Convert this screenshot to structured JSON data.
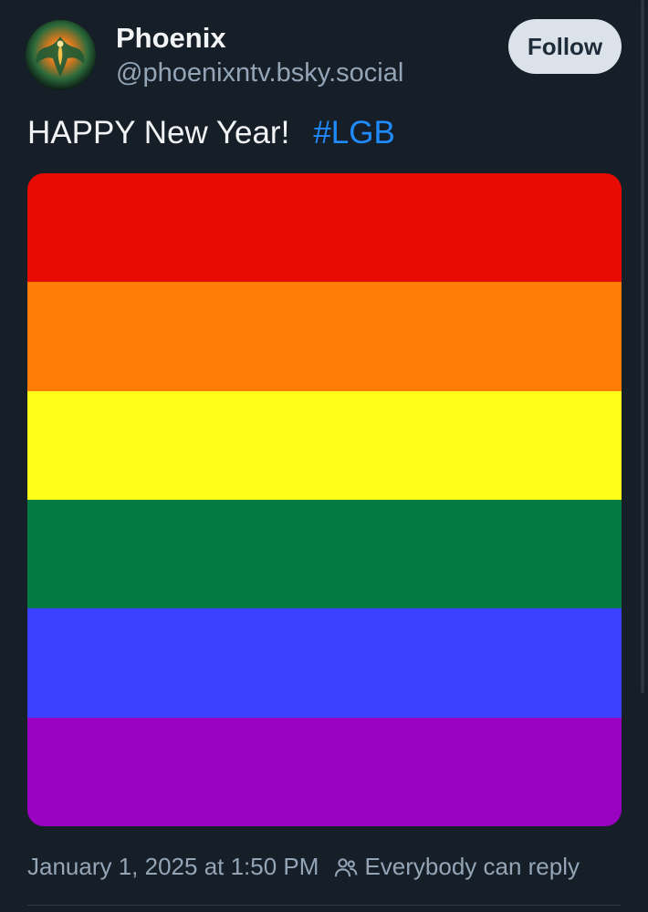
{
  "author": {
    "display_name": "Phoenix",
    "handle": "@phoenixntv.bsky.social",
    "avatar_icon": "phoenix-avatar"
  },
  "actions": {
    "follow_label": "Follow"
  },
  "post": {
    "text": "HAPPY New Year!",
    "hashtag": "#LGB",
    "image": {
      "description_icon": "rainbow-flag-image",
      "stripes": [
        {
          "color": "#e80b04"
        },
        {
          "color": "#ff7d04"
        },
        {
          "color": "#ffff17"
        },
        {
          "color": "#027a41"
        },
        {
          "color": "#3c41ff"
        },
        {
          "color": "#9a02c1"
        }
      ]
    },
    "timestamp": "January 1, 2025 at 1:50 PM",
    "reply_setting": "Everybody can reply",
    "reply_icon": "people-icon"
  },
  "colors": {
    "background": "#161e27",
    "link": "#208bfe",
    "muted": "#93a5b7"
  }
}
